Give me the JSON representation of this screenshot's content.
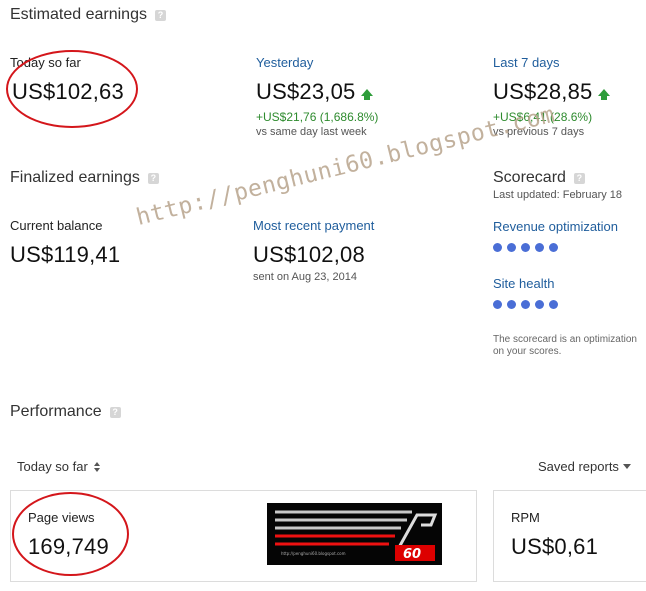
{
  "estimated": {
    "title": "Estimated earnings",
    "today": {
      "label": "Today so far",
      "amount": "US$102,63"
    },
    "yesterday": {
      "label": "Yesterday",
      "amount": "US$23,05",
      "change": "+US$21,76 (1,686.8%)",
      "compare": "vs same day last week"
    },
    "last7": {
      "label": "Last 7 days",
      "amount": "US$28,85",
      "change": "+US$6,41 (28.6%)",
      "compare": "vs previous 7 days"
    }
  },
  "finalized": {
    "title": "Finalized earnings",
    "balance": {
      "label": "Current balance",
      "amount": "US$119,41"
    },
    "payment": {
      "label": "Most recent payment",
      "amount": "US$102,08",
      "sent": "sent on Aug 23, 2014"
    }
  },
  "scorecard": {
    "title": "Scorecard",
    "updated": "Last updated: February 18",
    "revenue_label": "Revenue optimization",
    "site_health_label": "Site health",
    "revenue_dots": 5,
    "health_dots": 5,
    "note_line1": "The scorecard is an optimization",
    "note_line2": "on your scores."
  },
  "performance": {
    "title": "Performance",
    "range": "Today so far",
    "saved_reports": "Saved reports",
    "page_views": {
      "label": "Page views",
      "value": "169,749"
    },
    "rpm": {
      "label": "RPM",
      "value": "US$0,61"
    }
  },
  "watermark": "http://penghuni60.blogspot.com",
  "logo": {
    "small_text": "http://penghuni60.blogspot.com",
    "mark": "60"
  },
  "help_glyph": "?",
  "colors": {
    "link_blue": "#1f5d9c",
    "positive_green": "#2e8b2e",
    "circle_red": "#d4161b",
    "dot_blue": "#4a6ed6"
  }
}
